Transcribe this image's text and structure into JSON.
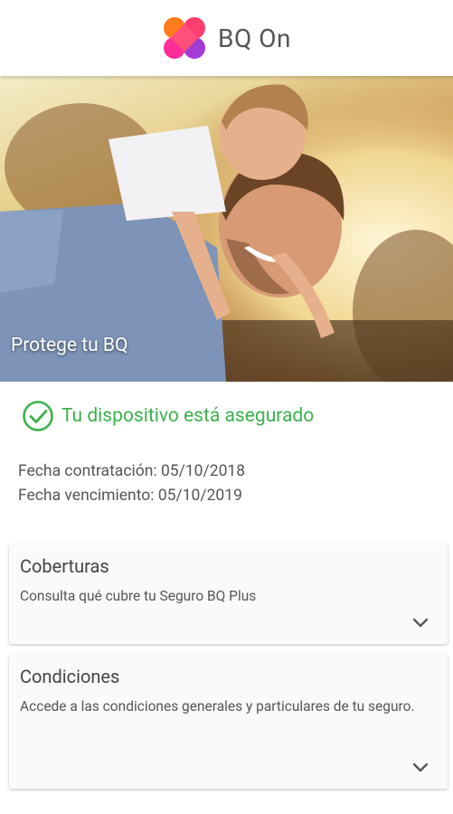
{
  "header": {
    "title": "BQ On",
    "logo_colors": [
      "#ff7a1a",
      "#ff2d7a",
      "#a43bd6",
      "#e63bd0"
    ]
  },
  "hero": {
    "caption": "Protege tu BQ"
  },
  "status": {
    "text": "Tu dispositivo está asegurado",
    "color": "#3db14c"
  },
  "dates": {
    "contract": "Fecha contratación: 05/10/2018",
    "expiry": "Fecha vencimiento: 05/10/2019"
  },
  "cards": [
    {
      "title": "Coberturas",
      "description": "Consulta qué cubre tu Seguro BQ Plus",
      "icon": "chevron-down-icon"
    },
    {
      "title": "Condiciones",
      "description": "Accede a las condiciones generales y particulares de tu seguro.",
      "icon": "chevron-down-icon"
    }
  ]
}
